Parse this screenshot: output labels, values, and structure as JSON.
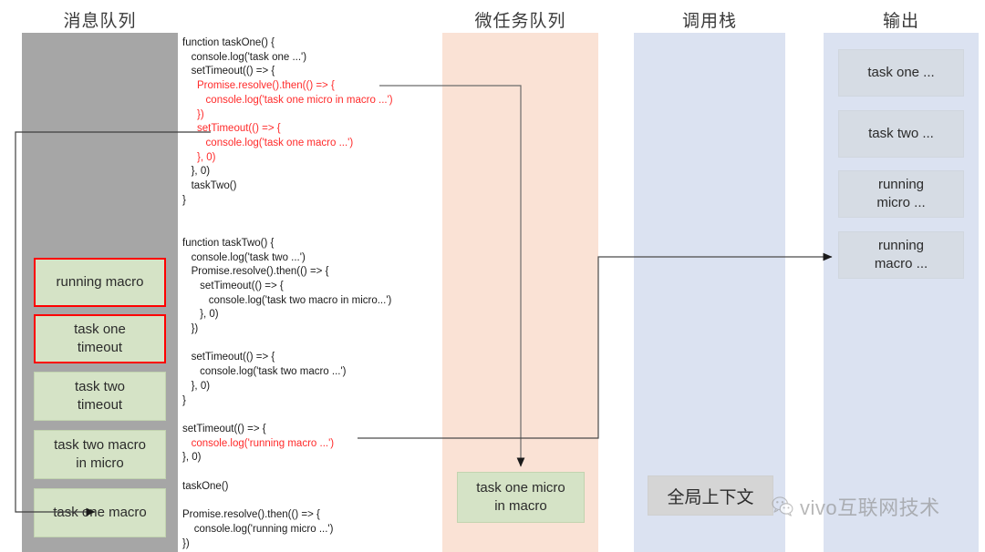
{
  "columns": [
    {
      "key": "message_queue",
      "title": "消息队列"
    },
    {
      "key": "microtask_queue",
      "title": "微任务队列"
    },
    {
      "key": "call_stack",
      "title": "调用栈"
    },
    {
      "key": "output",
      "title": "输出"
    }
  ],
  "message_queue": {
    "items": [
      {
        "label": "running macro",
        "highlighted": true
      },
      {
        "label": "task one\ntimeout",
        "highlighted": true
      },
      {
        "label": "task two\ntimeout",
        "highlighted": false
      },
      {
        "label": "task two macro\nin micro",
        "highlighted": false
      },
      {
        "label": "task one macro",
        "highlighted": false
      }
    ]
  },
  "microtask_queue": {
    "items": [
      {
        "label": "task one micro\nin macro"
      }
    ]
  },
  "call_stack": {
    "items": [
      {
        "label": "全局上下文"
      }
    ]
  },
  "output": {
    "items": [
      {
        "label": "task one ..."
      },
      {
        "label": "task two ..."
      },
      {
        "label": "running\nmicro ..."
      },
      {
        "label": "running\nmacro ..."
      }
    ]
  },
  "code": {
    "lines": [
      {
        "text": "function taskOne() {",
        "color": "black"
      },
      {
        "text": "   console.log('task one ...')",
        "color": "black"
      },
      {
        "text": "   setTimeout(() => {",
        "color": "black"
      },
      {
        "text": "     Promise.resolve().then(() => {",
        "color": "red"
      },
      {
        "text": "        console.log('task one micro in macro ...')",
        "color": "red"
      },
      {
        "text": "     })",
        "color": "red"
      },
      {
        "text": "     setTimeout(() => {",
        "color": "red"
      },
      {
        "text": "        console.log('task one macro ...')",
        "color": "red"
      },
      {
        "text": "     }, 0)",
        "color": "red"
      },
      {
        "text": "   }, 0)",
        "color": "black"
      },
      {
        "text": "   taskTwo()",
        "color": "black"
      },
      {
        "text": "}",
        "color": "black"
      },
      {
        "text": "",
        "color": "black"
      },
      {
        "text": "",
        "color": "black"
      },
      {
        "text": "function taskTwo() {",
        "color": "black"
      },
      {
        "text": "   console.log('task two ...')",
        "color": "black"
      },
      {
        "text": "   Promise.resolve().then(() => {",
        "color": "black"
      },
      {
        "text": "      setTimeout(() => {",
        "color": "black"
      },
      {
        "text": "         console.log('task two macro in micro...')",
        "color": "black"
      },
      {
        "text": "      }, 0)",
        "color": "black"
      },
      {
        "text": "   })",
        "color": "black"
      },
      {
        "text": "",
        "color": "black"
      },
      {
        "text": "   setTimeout(() => {",
        "color": "black"
      },
      {
        "text": "      console.log('task two macro ...')",
        "color": "black"
      },
      {
        "text": "   }, 0)",
        "color": "black"
      },
      {
        "text": "}",
        "color": "black"
      },
      {
        "text": "",
        "color": "black"
      },
      {
        "text": "setTimeout(() => {",
        "color": "black"
      },
      {
        "text": "   console.log('running macro ...')",
        "color": "red"
      },
      {
        "text": "}, 0)",
        "color": "black"
      },
      {
        "text": "",
        "color": "black"
      },
      {
        "text": "taskOne()",
        "color": "black"
      },
      {
        "text": "",
        "color": "black"
      },
      {
        "text": "Promise.resolve().then(() => {",
        "color": "black"
      },
      {
        "text": "    console.log('running micro ...')",
        "color": "black"
      },
      {
        "text": "})",
        "color": "black"
      }
    ]
  },
  "watermark": {
    "text": "vivo互联网技术"
  },
  "colors": {
    "message_band": "#a6a6a6",
    "microtask_band": "#fae2d5",
    "call_stack_band": "#dbe2f1",
    "output_band": "#dbe2f1",
    "queue_item": "#d5e3c6",
    "output_item": "#d6dce4",
    "highlight": "#ff0000",
    "code_accent": "#ff2a2a"
  }
}
